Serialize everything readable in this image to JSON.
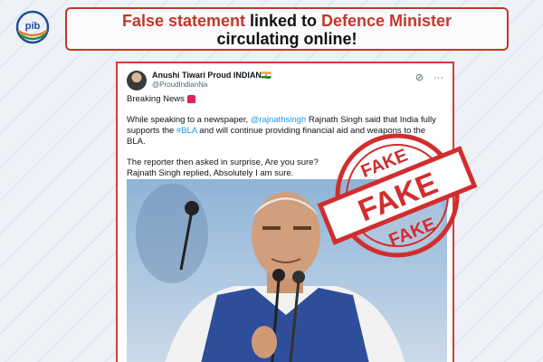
{
  "headline": {
    "part1": "False statement",
    "part2": " linked to ",
    "part3": "Defence Minister",
    "part4": "circulating online!"
  },
  "tweet": {
    "user_name": "Anushi Tiwari Proud INDIAN🇮🇳",
    "user_handle": "@ProudIndianNa",
    "line1": "Breaking News",
    "para1_a": "While speaking to a newspaper, ",
    "para1_mention": "@rajnathsingh",
    "para1_b": " Rajnath Singh said that India fully supports the ",
    "para1_hashtag": "#BLA",
    "para1_c": " and will continue providing financial aid and weapons to the BLA.",
    "para2_line1": "The reporter then asked in surprise, Are you sure?",
    "para2_line2": "Rajnath Singh replied, Absolutely I am sure."
  },
  "stamp": {
    "top_text": "FAKE",
    "center_text": "FAKE",
    "bottom_text": "FAKE"
  },
  "colors": {
    "accent_red": "#c0392b",
    "link_blue": "#1d9bf0"
  },
  "icons": [
    "pib-logo-icon",
    "grok-icon",
    "more-icon",
    "siren-icon"
  ]
}
